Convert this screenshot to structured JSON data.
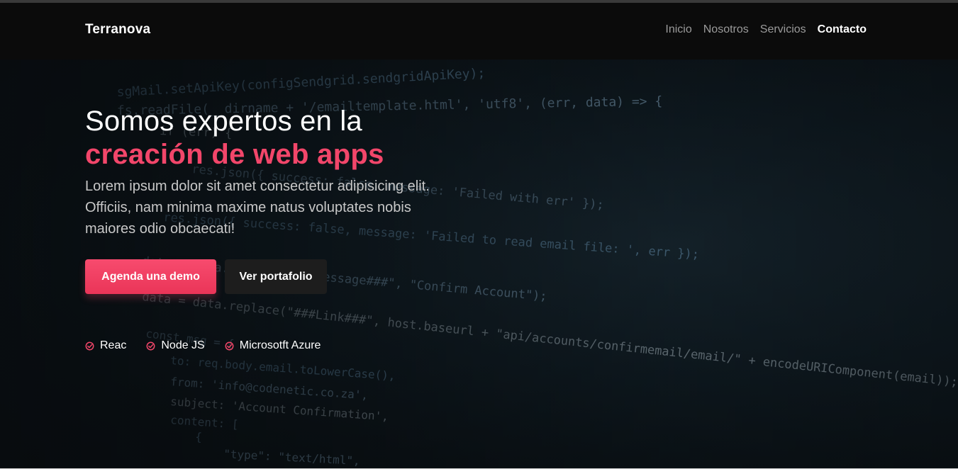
{
  "brand": "Terranova",
  "nav": {
    "items": [
      {
        "label": "Inicio",
        "active": false
      },
      {
        "label": "Nosotros",
        "active": false
      },
      {
        "label": "Servicios",
        "active": false
      },
      {
        "label": "Contacto",
        "active": true
      }
    ]
  },
  "hero": {
    "headline_line1": "Somos expertos en la",
    "headline_line2": "creación de web apps",
    "lead": "Lorem ipsum dolor sit amet consectetur adipisicing elit. Officiis, nam minima maxime natus voluptates nobis maiores odio obcaecati!",
    "primary_button": "Agenda una demo",
    "secondary_button": "Ver portafolio",
    "technologies": [
      {
        "label": "Reac",
        "icon": "check-circle-icon"
      },
      {
        "label": "Node JS",
        "icon": "check-circle-icon"
      },
      {
        "label": "Microsotft Azure",
        "icon": "check-circle-icon"
      }
    ]
  },
  "background_code": [
    "sgMail.setApiKey(configSendgrid.sendgridApiKey);",
    "fs.readFile(__dirname + '/emailtemplate.html', 'utf8', (err, data) => {",
    "if (err) {",
    "res.json({ success: false, message: 'Failed with err' });",
    "res.json({ success: false, message: 'Failed to read email file: ', err });",
    "data = data.replace(\"###Message###\", \"Confirm Account\");",
    "data = data.replace(\"###Link###\", host.baseurl + \"api/accounts/confirmemail/email/\" + encodeURIComponent(email));",
    "const msg = {",
    "to: req.body.email.toLowerCase(),",
    "from: 'info@codenetic.co.za',",
    "subject: 'Account Confirmation',",
    "content: [",
    "{",
    "\"type\": \"text/html\","
  ],
  "colors": {
    "accent": "#f2466a",
    "navbar_bg": "#0b0b0b",
    "secondary_button_bg": "#1d1d1d",
    "hero_bg": "#0f1a21"
  }
}
